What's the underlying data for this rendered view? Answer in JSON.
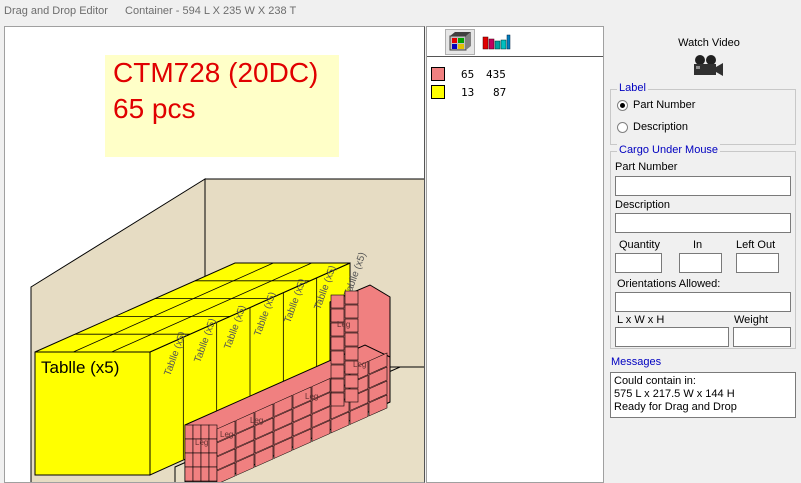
{
  "title_bar": {
    "app_title": "Drag and Drop Editor",
    "container_info": "Container - 594 L X 235 W X 238 T"
  },
  "canvas": {
    "container_name": "CTM728 (20DC)",
    "piece_count": "65 pcs",
    "front_item_label": "Tablle (x5)",
    "item_labels": [
      "Tablle (x5)",
      "Tablle (x5)",
      "Tablle (x5)",
      "Tablle (x5)",
      "Tablle (x5)",
      "Tablle (x5)",
      "Tablle (x5)"
    ],
    "pink_box_label": "Leg"
  },
  "legend": {
    "rows": [
      {
        "color": "#f08080",
        "count": "65",
        "value": "435"
      },
      {
        "color": "#ffff00",
        "count": "13",
        "value": "87"
      }
    ]
  },
  "right_panel": {
    "watch_video": "Watch Video",
    "label_group": {
      "title": "Label",
      "options": [
        {
          "label": "Part Number",
          "checked": true
        },
        {
          "label": "Description",
          "checked": false
        }
      ]
    },
    "cargo_group": {
      "title": "Cargo Under Mouse",
      "part_number_label": "Part Number",
      "part_number_value": "",
      "description_label": "Description",
      "description_value": "",
      "quantity_label": "Quantity",
      "quantity_value": "",
      "in_label": "In",
      "in_value": "",
      "left_out_label": "Left Out",
      "left_out_value": "",
      "orientations_label": "Orientations Allowed:",
      "orientations_value": "",
      "lwh_label": "L x W x H",
      "lwh_value": "",
      "weight_label": "Weight",
      "weight_value": ""
    },
    "messages": {
      "title": "Messages",
      "lines": [
        "Could contain in:",
        "575 L x 217.5 W x 144 H",
        "Ready for Drag and Drop"
      ]
    }
  },
  "colors": {
    "banner_text": "#e00000",
    "banner_bg": "#ffffc8",
    "container_wall": "#e6dcc3",
    "yellow_cargo": "#ffff00",
    "pink_cargo": "#f08080",
    "group_title": "#0000c0"
  }
}
